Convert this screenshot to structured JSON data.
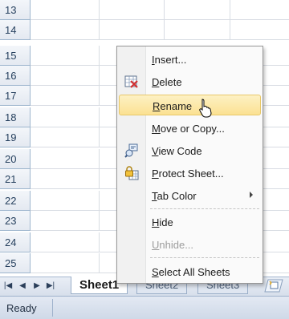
{
  "rows": [
    "13",
    "14",
    "15",
    "16",
    "17",
    "18",
    "19",
    "20",
    "21",
    "22",
    "23",
    "24",
    "25"
  ],
  "sheet_nav": [
    "|◀",
    "◀",
    "▶",
    "▶|"
  ],
  "tabs": [
    {
      "label": "Sheet1",
      "active": true
    },
    {
      "label": "Sheet2",
      "active": false
    },
    {
      "label": "Sheet3",
      "active": false
    }
  ],
  "status": {
    "text": "Ready"
  },
  "context_menu": {
    "items": [
      {
        "label": "Insert...",
        "underline": "I",
        "icon": "",
        "disabled": false,
        "submenu": false,
        "highlight": false
      },
      {
        "label": "Delete",
        "underline": "D",
        "icon": "delete-sheet-icon",
        "disabled": false,
        "submenu": false,
        "highlight": false
      },
      {
        "label": "Rename",
        "underline": "R",
        "icon": "",
        "disabled": false,
        "submenu": false,
        "highlight": true
      },
      {
        "label": "Move or Copy...",
        "underline": "M",
        "icon": "",
        "disabled": false,
        "submenu": false,
        "highlight": false
      },
      {
        "label": "View Code",
        "underline": "V",
        "icon": "view-code-icon",
        "disabled": false,
        "submenu": false,
        "highlight": false
      },
      {
        "label": "Protect Sheet...",
        "underline": "P",
        "icon": "protect-sheet-icon",
        "disabled": false,
        "submenu": false,
        "highlight": false
      },
      {
        "label": "Tab Color",
        "underline": "T",
        "icon": "",
        "disabled": false,
        "submenu": true,
        "highlight": false
      },
      {
        "label": "Hide",
        "underline": "H",
        "icon": "",
        "disabled": false,
        "submenu": false,
        "highlight": false
      },
      {
        "label": "Unhide...",
        "underline": "U",
        "icon": "",
        "disabled": true,
        "submenu": false,
        "highlight": false
      },
      {
        "label": "Select All Sheets",
        "underline": "S",
        "icon": "",
        "disabled": false,
        "submenu": false,
        "highlight": false
      }
    ]
  },
  "colors": {
    "highlight": "#fbe192",
    "header_bg": "#e4e9f1",
    "grid_line": "#d8dce3"
  }
}
